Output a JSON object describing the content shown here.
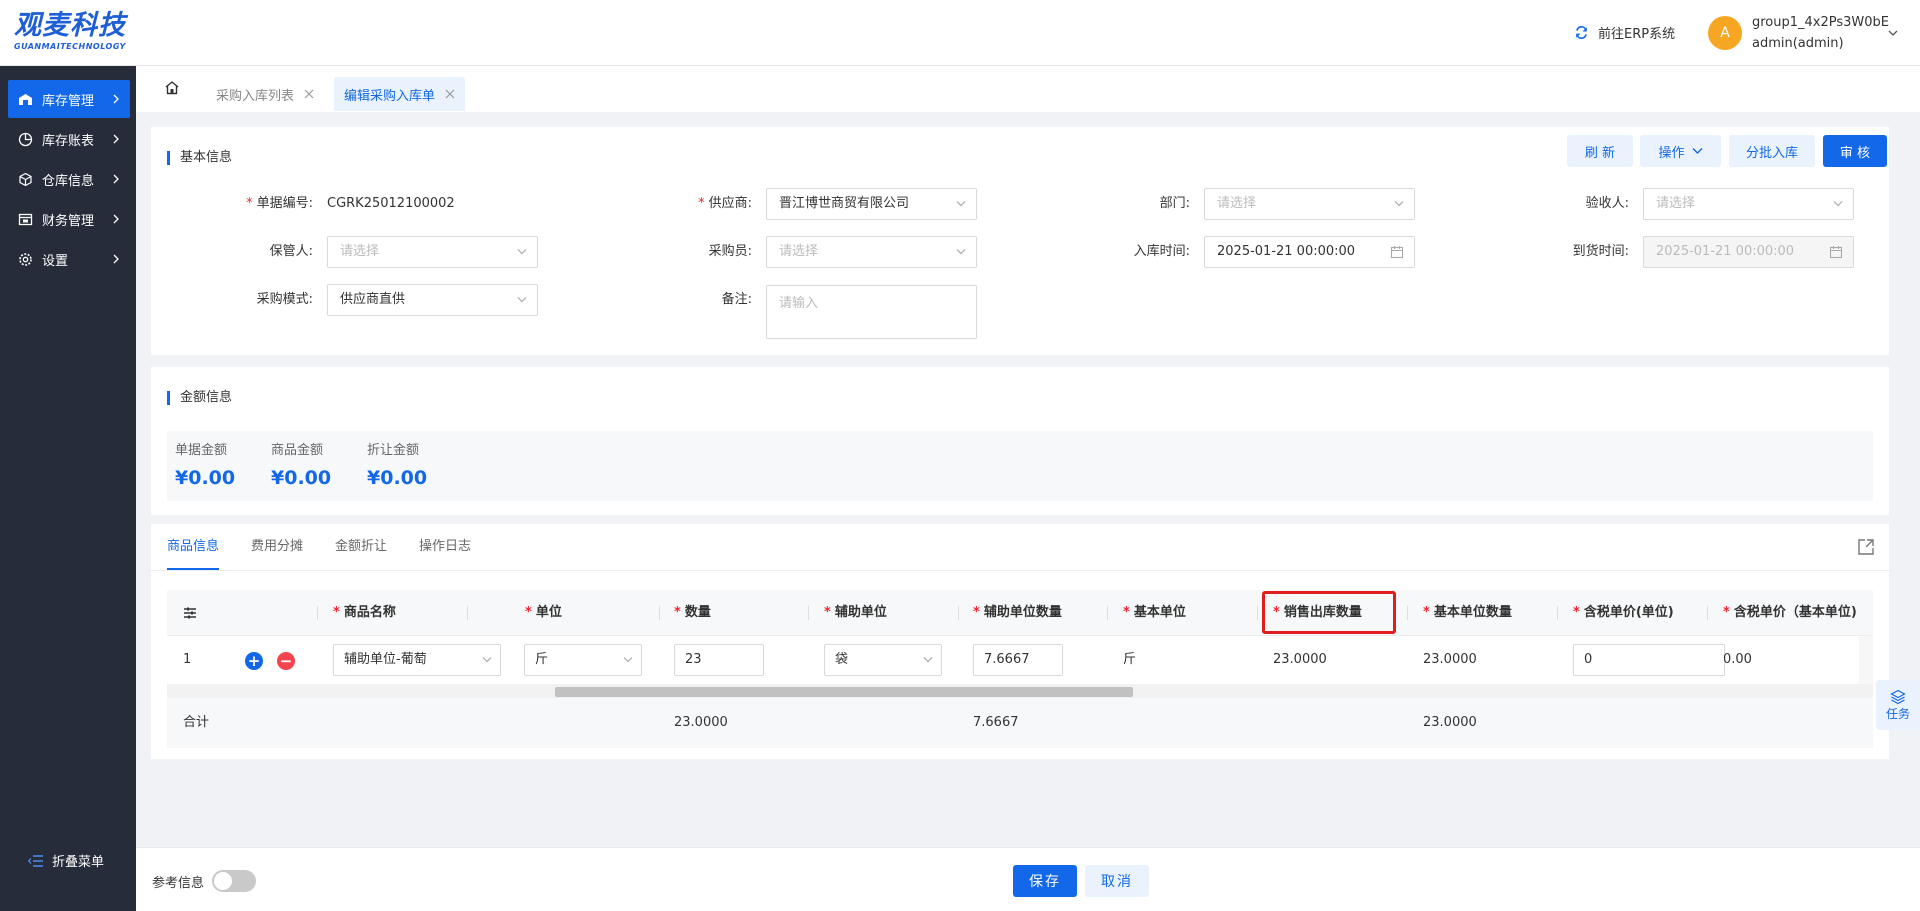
{
  "header": {
    "logo_cn": "观麦科技",
    "logo_en": "GUANMAITECHNOLOGY",
    "erp_link": "前往ERP系统",
    "avatar_letter": "A",
    "user_group": "group1_4x2Ps3W0bE",
    "user_name": "admin(admin)"
  },
  "sidebar": {
    "items": [
      {
        "label": "库存管理",
        "icon": "warehouse-icon",
        "active": true
      },
      {
        "label": "库存账表",
        "icon": "pie-chart-icon"
      },
      {
        "label": "仓库信息",
        "icon": "cube-icon"
      },
      {
        "label": "财务管理",
        "icon": "finance-icon"
      },
      {
        "label": "设置",
        "icon": "gear-icon"
      }
    ],
    "collapse_label": "折叠菜单"
  },
  "tabs": [
    {
      "label": "采购入库列表",
      "active": false
    },
    {
      "label": "编辑采购入库单",
      "active": true
    }
  ],
  "basic": {
    "title": "基本信息",
    "buttons": {
      "refresh": "刷 新",
      "operate": "操作",
      "batch": "分批入库",
      "audit": "审 核"
    },
    "fields": {
      "doc_no": {
        "label": "单据编号:",
        "value": "CGRK25012100002"
      },
      "supplier": {
        "label": "供应商:",
        "value": "晋江博世商贸有限公司"
      },
      "dept": {
        "label": "部门:",
        "placeholder": "请选择"
      },
      "inspector": {
        "label": "验收人:",
        "placeholder": "请选择"
      },
      "keeper": {
        "label": "保管人:",
        "placeholder": "请选择"
      },
      "buyer": {
        "label": "采购员:",
        "placeholder": "请选择"
      },
      "in_time": {
        "label": "入库时间:",
        "value": "2025-01-21 00:00:00"
      },
      "arrive_time": {
        "label": "到货时间:",
        "value": "2025-01-21 00:00:00"
      },
      "mode": {
        "label": "采购模式:",
        "value": "供应商直供"
      },
      "remark": {
        "label": "备注:",
        "placeholder": "请输入"
      }
    }
  },
  "amount": {
    "title": "金额信息",
    "items": [
      {
        "label": "单据金额",
        "value": "¥0.00"
      },
      {
        "label": "商品金额",
        "value": "¥0.00"
      },
      {
        "label": "折让金额",
        "value": "¥0.00"
      }
    ]
  },
  "goods": {
    "subtabs": [
      "商品信息",
      "费用分摊",
      "金额折让",
      "操作日志"
    ],
    "columns": {
      "name": "商品名称",
      "unit": "单位",
      "qty": "数量",
      "aux_unit": "辅助单位",
      "aux_qty": "辅助单位数量",
      "base_unit": "基本单位",
      "sale_out_qty": "销售出库数量",
      "base_qty": "基本单位数量",
      "tax_price_unit": "含税单价(单位)",
      "tax_price_base": "含税单价（基本单位)"
    },
    "row": {
      "index": "1",
      "name": "辅助单位-葡萄",
      "unit": "斤",
      "qty": "23",
      "aux_unit": "袋",
      "aux_qty": "7.6667",
      "base_unit": "斤",
      "sale_out_qty": "23.0000",
      "base_qty": "23.0000",
      "tax_price_unit": "0",
      "tax_price_base": "0.00"
    },
    "footer": {
      "label": "合计",
      "qty": "23.0000",
      "aux_qty": "7.6667",
      "base_qty": "23.0000"
    }
  },
  "task_label": "任务",
  "bottom": {
    "ref_label": "参考信息",
    "save": "保存",
    "cancel": "取消"
  }
}
